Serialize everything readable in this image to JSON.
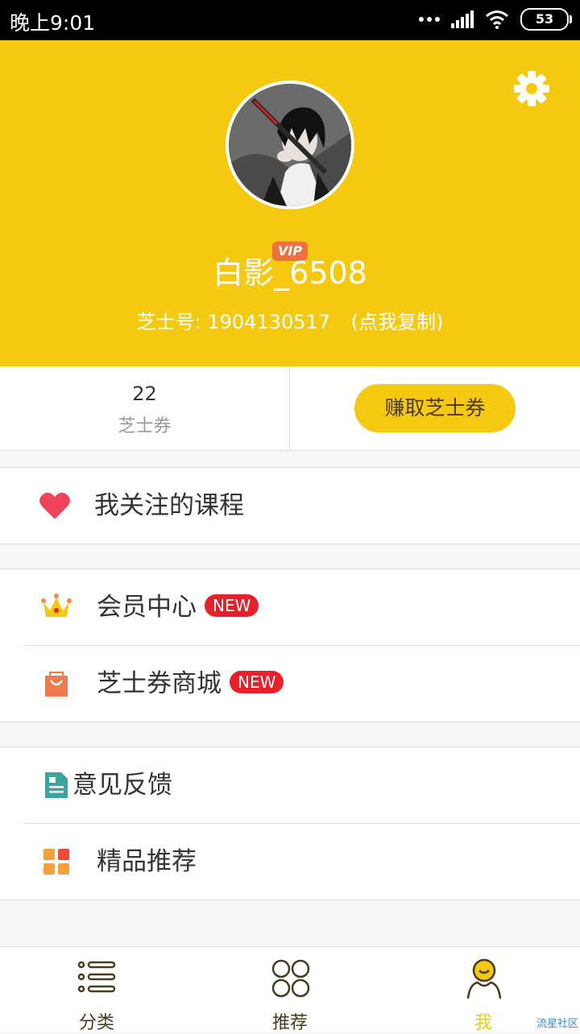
{
  "status_bar": {
    "time": "晚上9:01",
    "battery": "53"
  },
  "profile": {
    "username": "白影_6508",
    "id_label": "芝士号:",
    "id_value": "1904130517",
    "copy_hint": "(点我复制)",
    "vip_badge": "VIP",
    "settings_icon": "gear-icon"
  },
  "stats": {
    "coupon_count": "22",
    "coupon_label": "芝士券",
    "earn_button": "赚取芝士券"
  },
  "menu": {
    "followed_courses": "我关注的课程",
    "member_center": "会员中心",
    "coupon_mall": "芝士券商城",
    "new_badge": "NEW",
    "feedback": "意见反馈",
    "recommended": "精品推荐"
  },
  "tabbar": {
    "tabs": [
      {
        "label": "分类",
        "icon": "list-icon"
      },
      {
        "label": "推荐",
        "icon": "grid-circles-icon"
      },
      {
        "label": "我",
        "icon": "user-icon"
      }
    ],
    "active": "我"
  },
  "watermark": "流星社区",
  "colors": {
    "accent": "#f5c90f",
    "badge_red": "#e8202a",
    "text_dark": "#333333"
  }
}
